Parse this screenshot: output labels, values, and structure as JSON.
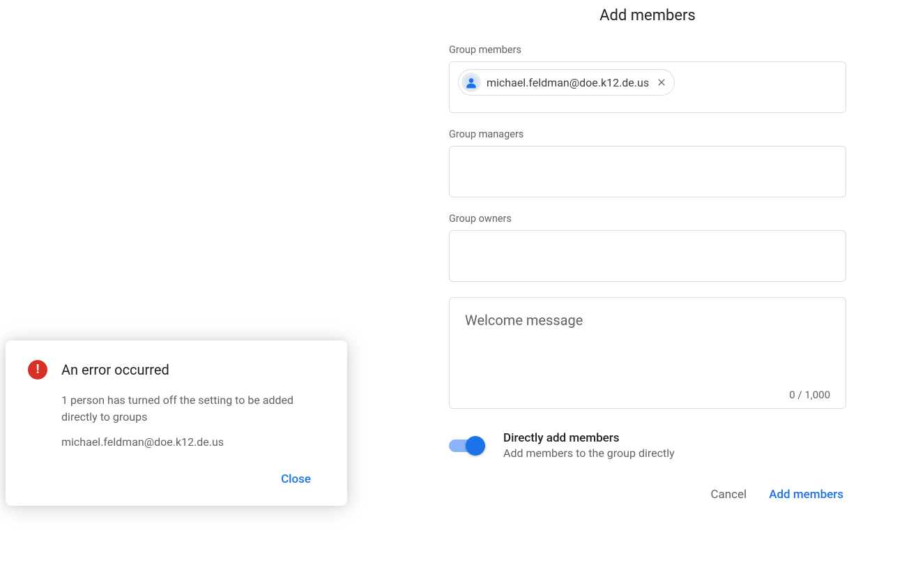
{
  "panel": {
    "title": "Add members",
    "fields": {
      "members": {
        "label": "Group members",
        "chip_email": "michael.feldman@doe.k12.de.us"
      },
      "managers": {
        "label": "Group managers"
      },
      "owners": {
        "label": "Group owners"
      },
      "welcome": {
        "placeholder": "Welcome message",
        "count": "0 / 1,000"
      }
    },
    "toggle": {
      "title": "Directly add members",
      "desc": "Add members to the group directly",
      "on": true
    },
    "buttons": {
      "cancel": "Cancel",
      "submit": "Add members"
    }
  },
  "errorDialog": {
    "title": "An error occurred",
    "message": "1 person has turned off the setting to be added directly to groups",
    "email": "michael.feldman@doe.k12.de.us",
    "close": "Close"
  }
}
